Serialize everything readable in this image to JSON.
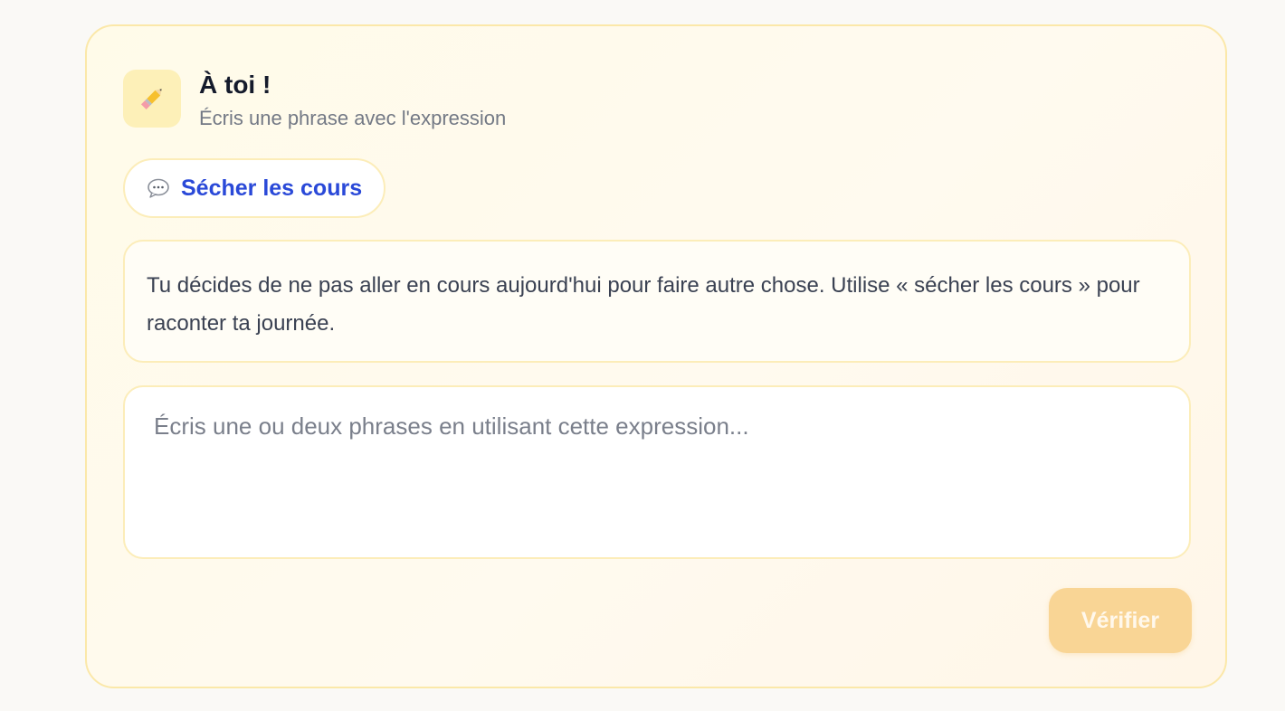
{
  "header": {
    "icon": "pencil-icon",
    "title": "À toi !",
    "subtitle": "Écris une phrase avec l'expression"
  },
  "expression": {
    "icon": "speech-bubble-icon",
    "label": "Sécher les cours"
  },
  "prompt": {
    "text": "Tu décides de ne pas aller en cours aujourd'hui pour faire autre chose. Utilise « sécher les cours » pour raconter ta journée."
  },
  "answer": {
    "value": "",
    "placeholder": "Écris une ou deux phrases en utilisant cette expression..."
  },
  "verify_button": {
    "label": "Vérifier"
  },
  "colors": {
    "accent_blue": "#2a49d8",
    "button_disabled": "#f9d595",
    "card_border": "#fbe8a9"
  }
}
